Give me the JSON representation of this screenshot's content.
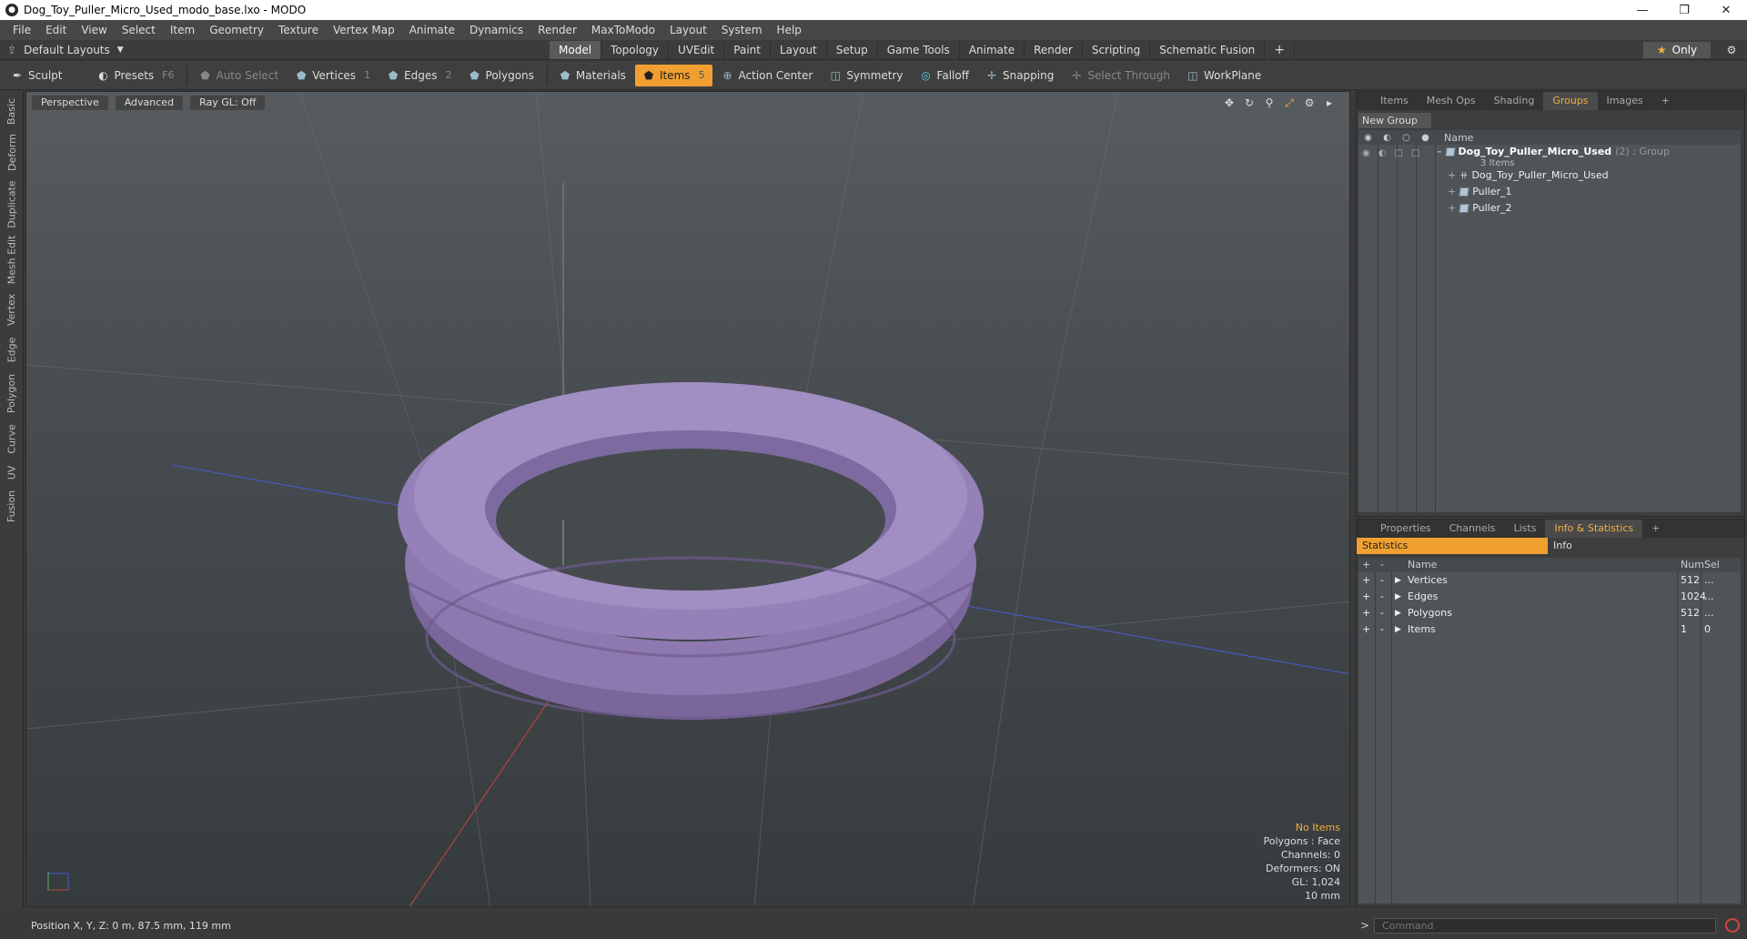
{
  "window": {
    "title": "Dog_Toy_Puller_Micro_Used_modo_base.lxo - MODO"
  },
  "menu": [
    "File",
    "Edit",
    "View",
    "Select",
    "Item",
    "Geometry",
    "Texture",
    "Vertex Map",
    "Animate",
    "Dynamics",
    "Render",
    "MaxToModo",
    "Layout",
    "System",
    "Help"
  ],
  "layout": {
    "preset": "Default Layouts",
    "tabs": [
      "Model",
      "Topology",
      "UVEdit",
      "Paint",
      "Layout",
      "Setup",
      "Game Tools",
      "Animate",
      "Render",
      "Scripting",
      "Schematic Fusion"
    ],
    "active_tab": "Model",
    "only_label": "Only"
  },
  "toolbar": {
    "sculpt": "Sculpt",
    "presets": "Presets",
    "presets_key": "F6",
    "auto_select": "Auto Select",
    "vertices": "Vertices",
    "vertices_key": "1",
    "edges": "Edges",
    "edges_key": "2",
    "polygons": "Polygons",
    "materials": "Materials",
    "items": "Items",
    "items_key": "5",
    "action_center": "Action Center",
    "symmetry": "Symmetry",
    "falloff": "Falloff",
    "snapping": "Snapping",
    "select_through": "Select Through",
    "workplane": "WorkPlane"
  },
  "left_tabs": [
    "Basic",
    "Deform",
    "Duplicate",
    "Mesh Edit",
    "Vertex",
    "Edge",
    "Polygon",
    "Curve",
    "UV",
    "Fusion"
  ],
  "viewport": {
    "view": "Perspective",
    "shading": "Advanced",
    "raygl": "Ray GL: Off",
    "stats": {
      "no_items": "No Items",
      "polygons": "Polygons : Face",
      "channels": "Channels: 0",
      "deformers": "Deformers: ON",
      "gl": "GL: 1,024",
      "scale": "10 mm"
    },
    "mesh_color": "#8e78b0"
  },
  "status": {
    "position": "Position X, Y, Z:  0 m, 87.5 mm, 119 mm"
  },
  "top_panel": {
    "tabs": [
      "Items",
      "Mesh Ops",
      "Shading",
      "Groups",
      "Images"
    ],
    "active_tab": "Groups",
    "new_group": "New Group",
    "name_header": "Name",
    "group": {
      "name": "Dog_Toy_Puller_Micro_Used",
      "count": "(2) : Group",
      "sub": "3 Items"
    },
    "children": [
      "Dog_Toy_Puller_Micro_Used",
      "Puller_1",
      "Puller_2"
    ]
  },
  "bottom_panel": {
    "tabs": [
      "Properties",
      "Channels",
      "Lists",
      "Info & Statistics"
    ],
    "active_tab": "Info & Statistics",
    "sub_tabs": {
      "statistics": "Statistics",
      "info": "Info"
    },
    "headers": {
      "name": "Name",
      "num": "Num",
      "sel": "Sel"
    },
    "rows": [
      {
        "name": "Vertices",
        "num": "512",
        "sel": "..."
      },
      {
        "name": "Edges",
        "num": "1024",
        "sel": "..."
      },
      {
        "name": "Polygons",
        "num": "512",
        "sel": "..."
      },
      {
        "name": "Items",
        "num": "1",
        "sel": "0"
      }
    ]
  },
  "command": {
    "placeholder": "Command"
  },
  "colors": {
    "accent": "#f0a030",
    "highlight": "#f0b040"
  }
}
